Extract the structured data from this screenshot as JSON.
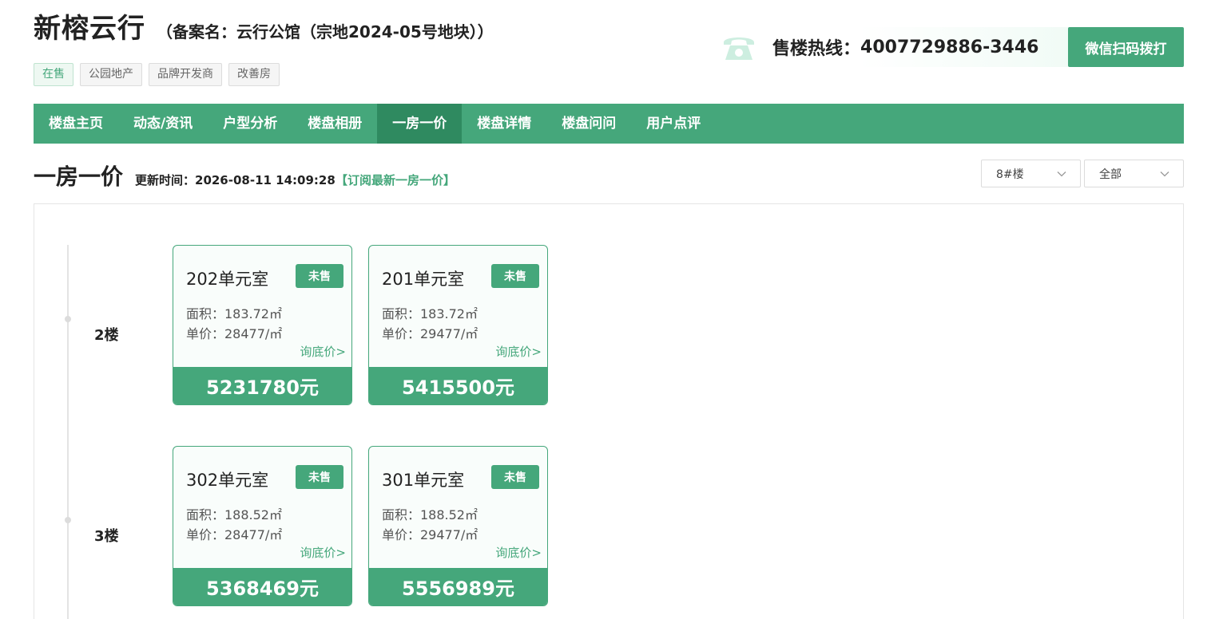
{
  "header": {
    "title": "新榕云行",
    "subtitle": "（备案名：云行公馆（宗地2024-05号地块））",
    "tags": [
      {
        "label": "在售",
        "active": true
      },
      {
        "label": "公园地产",
        "active": false
      },
      {
        "label": "品牌开发商",
        "active": false
      },
      {
        "label": "改善房",
        "active": false
      }
    ],
    "hotline_label": "售楼热线：",
    "hotline_number": "4007729886-3446",
    "wechat_button": "微信扫码拨打",
    "phone_icon": "phone-icon",
    "accent_color": "#45a77b"
  },
  "nav": {
    "items": [
      {
        "label": "楼盘主页",
        "active": false
      },
      {
        "label": "动态/资讯",
        "active": false
      },
      {
        "label": "户型分析",
        "active": false
      },
      {
        "label": "楼盘相册",
        "active": false
      },
      {
        "label": "一房一价",
        "active": true
      },
      {
        "label": "楼盘详情",
        "active": false
      },
      {
        "label": "楼盘问问",
        "active": false
      },
      {
        "label": "用户点评",
        "active": false
      }
    ]
  },
  "section": {
    "title": "一房一价",
    "update_text": "更新时间：2026-08-11 14:09:28",
    "subscribe_link": "【订阅最新一房一价】",
    "building_select": "8#楼",
    "status_select": "全部"
  },
  "floors": [
    {
      "label": "2楼",
      "units": [
        {
          "name": "202单元室",
          "status": "未售",
          "area": "面积：183.72㎡",
          "unit_price": "单价：28477/㎡",
          "ask": "询底价>",
          "total": "5231780元"
        },
        {
          "name": "201单元室",
          "status": "未售",
          "area": "面积：183.72㎡",
          "unit_price": "单价：29477/㎡",
          "ask": "询底价>",
          "total": "5415500元"
        }
      ]
    },
    {
      "label": "3楼",
      "units": [
        {
          "name": "302单元室",
          "status": "未售",
          "area": "面积：188.52㎡",
          "unit_price": "单价：28477/㎡",
          "ask": "询底价>",
          "total": "5368469元"
        },
        {
          "name": "301单元室",
          "status": "未售",
          "area": "面积：188.52㎡",
          "unit_price": "单价：29477/㎡",
          "ask": "询底价>",
          "total": "5556989元"
        }
      ]
    }
  ]
}
